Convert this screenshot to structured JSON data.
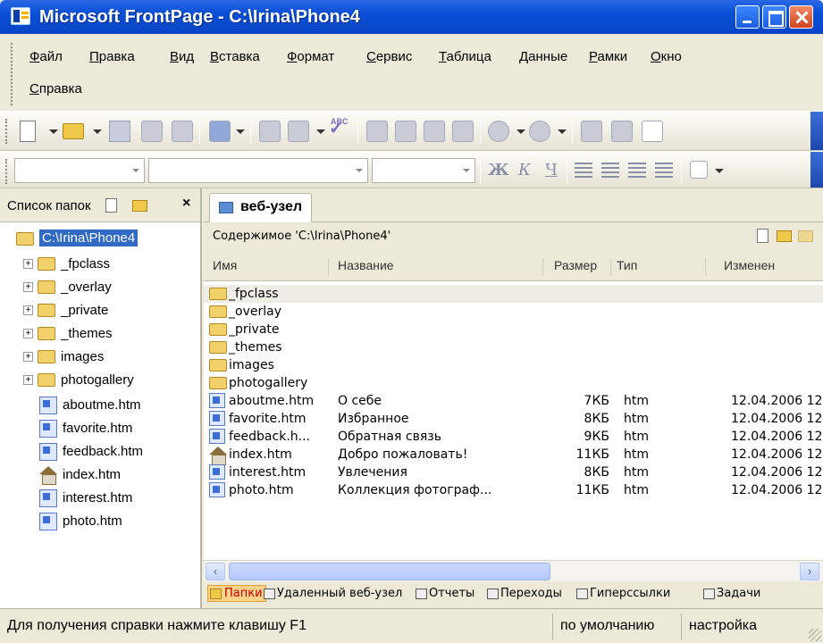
{
  "window": {
    "title": "Microsoft FrontPage - C:\\Irina\\Phone4"
  },
  "menu": {
    "items": [
      "Файл",
      "Правка",
      "Вид",
      "Вставка",
      "Формат",
      "Сервис",
      "Таблица",
      "Данные",
      "Рамки",
      "Окно",
      "Справка"
    ]
  },
  "toolbar": {
    "standard_icons": [
      "new-page-icon",
      "open-folder-icon",
      "save-icon",
      "search-icon",
      "publish-icon",
      "web-component-icon",
      "print-icon",
      "preview-icon",
      "spelling-icon",
      "cut-icon",
      "copy-icon",
      "paste-icon",
      "format-painter-icon",
      "undo-icon",
      "redo-icon",
      "insert-table-icon",
      "insert-layer-icon",
      "frame-icon"
    ],
    "spelling_glyph": "ABC",
    "format": {
      "style_value": "",
      "font_value": "",
      "size_value": "",
      "bold": "Ж",
      "italic": "К",
      "underline": "Ч"
    }
  },
  "folder_pane": {
    "title": "Список папок",
    "close_glyph": "×",
    "root": "C:\\Irina\\Phone4",
    "folders": [
      "_fpclass",
      "_overlay",
      "_private",
      "_themes",
      "images",
      "photogallery"
    ],
    "files": [
      {
        "name": "aboutme.htm",
        "icon": "page-icon"
      },
      {
        "name": "favorite.htm",
        "icon": "page-icon"
      },
      {
        "name": "feedback.htm",
        "icon": "page-icon"
      },
      {
        "name": "index.htm",
        "icon": "home-page-icon"
      },
      {
        "name": "interest.htm",
        "icon": "page-icon"
      },
      {
        "name": "photo.htm",
        "icon": "page-icon"
      }
    ]
  },
  "main": {
    "tab_label": "веб-узел",
    "content_header": "Содержимое 'C:\\Irina\\Phone4'",
    "columns": [
      "Имя",
      "Название",
      "Размер",
      "Тип",
      "Изменен"
    ],
    "folders": [
      "_fpclass",
      "_overlay",
      "_private",
      "_themes",
      "images",
      "photogallery"
    ],
    "files": [
      {
        "name": "aboutme.htm",
        "title": "О себе",
        "size": "7КБ",
        "type": "htm",
        "modified": "12.04.2006 12",
        "icon": "page-icon"
      },
      {
        "name": "favorite.htm",
        "title": "Избранное",
        "size": "8КБ",
        "type": "htm",
        "modified": "12.04.2006 12",
        "icon": "page-icon"
      },
      {
        "name": "feedback.h...",
        "title": "Обратная связь",
        "size": "9КБ",
        "type": "htm",
        "modified": "12.04.2006 12",
        "icon": "page-icon"
      },
      {
        "name": "index.htm",
        "title": "Добро пожаловать!",
        "size": "11КБ",
        "type": "htm",
        "modified": "12.04.2006 12",
        "icon": "home-page-icon"
      },
      {
        "name": "interest.htm",
        "title": "Увлечения",
        "size": "8КБ",
        "type": "htm",
        "modified": "12.04.2006 12",
        "icon": "page-icon"
      },
      {
        "name": "photo.htm",
        "title": "Коллекция фотограф...",
        "size": "11КБ",
        "type": "htm",
        "modified": "12.04.2006 12",
        "icon": "page-icon"
      }
    ],
    "scroll_left": "‹",
    "scroll_right": "›"
  },
  "view_bar": {
    "items": [
      "Папки",
      "Удаленный веб-узел",
      "Отчеты",
      "Переходы",
      "Гиперссылки",
      "Задачи"
    ]
  },
  "status": {
    "text": "Для получения справки нажмите клавишу F1",
    "mode": "по умолчанию",
    "settings": "настройка"
  },
  "colors": {
    "titlebar": "#0a4fd6",
    "selection": "#316ac5",
    "folder": "#f2d06a"
  }
}
